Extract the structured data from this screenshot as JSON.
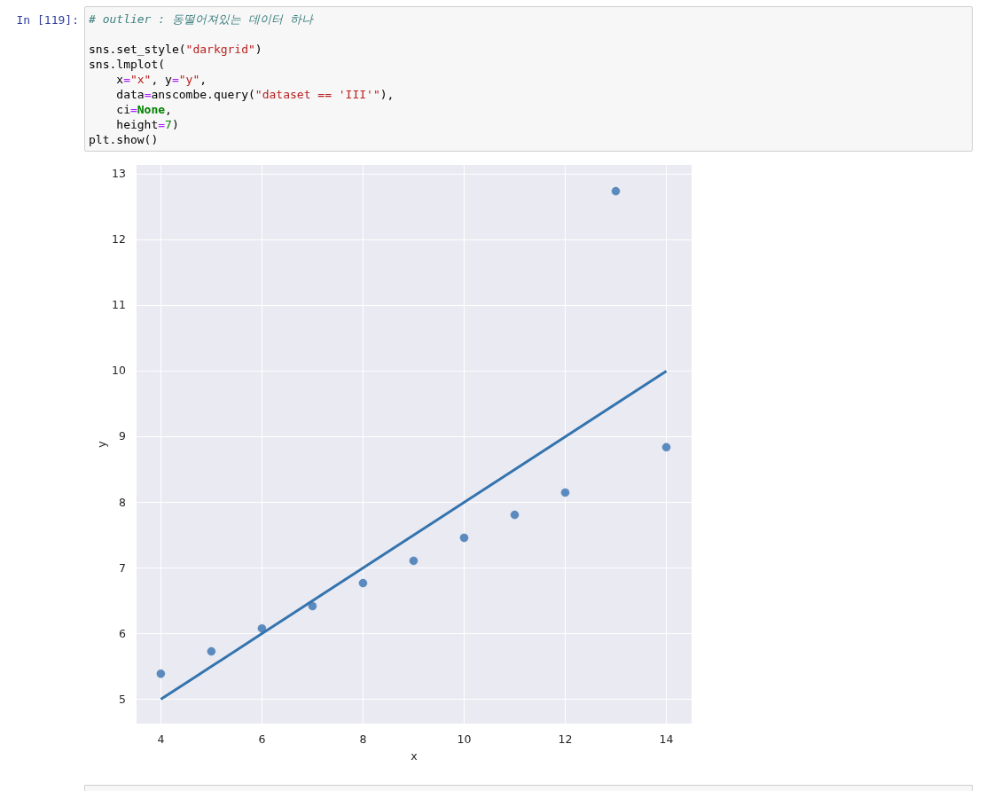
{
  "cell": {
    "prompt": "In [119]:",
    "lines": [
      {
        "tokens": [
          {
            "kind": "comment",
            "text": "# outlier : 동떨어져있는 데이터 하나"
          }
        ]
      },
      {
        "gap_before": true,
        "tokens": [
          {
            "kind": "plain",
            "text": "sns.set_style("
          },
          {
            "kind": "string",
            "text": "\"darkgrid\""
          },
          {
            "kind": "plain",
            "text": ")"
          }
        ]
      },
      {
        "tokens": [
          {
            "kind": "plain",
            "text": "sns.lmplot("
          }
        ]
      },
      {
        "tokens": [
          {
            "kind": "plain",
            "text": "    x"
          },
          {
            "kind": "op",
            "text": "="
          },
          {
            "kind": "string",
            "text": "\"x\""
          },
          {
            "kind": "plain",
            "text": ", y"
          },
          {
            "kind": "op",
            "text": "="
          },
          {
            "kind": "string",
            "text": "\"y\""
          },
          {
            "kind": "plain",
            "text": ","
          }
        ]
      },
      {
        "tokens": [
          {
            "kind": "plain",
            "text": "    data"
          },
          {
            "kind": "op",
            "text": "="
          },
          {
            "kind": "plain",
            "text": "anscombe.query("
          },
          {
            "kind": "string",
            "text": "\"dataset == 'III'\""
          },
          {
            "kind": "plain",
            "text": "),"
          }
        ]
      },
      {
        "tokens": [
          {
            "kind": "plain",
            "text": "    ci"
          },
          {
            "kind": "op",
            "text": "="
          },
          {
            "kind": "keyword",
            "text": "None"
          },
          {
            "kind": "plain",
            "text": ","
          }
        ]
      },
      {
        "tokens": [
          {
            "kind": "plain",
            "text": "    height"
          },
          {
            "kind": "op",
            "text": "="
          },
          {
            "kind": "number",
            "text": "7"
          },
          {
            "kind": "plain",
            "text": ")"
          }
        ]
      },
      {
        "tokens": [
          {
            "kind": "plain",
            "text": "plt.show()"
          }
        ]
      }
    ]
  },
  "output": {
    "chart_data": {
      "type": "scatter",
      "xlabel": "x",
      "ylabel": "y",
      "x": [
        4,
        5,
        6,
        7,
        8,
        9,
        10,
        11,
        12,
        13,
        14
      ],
      "series": [
        {
          "color": "#4a7fb8",
          "values": [
            5.39,
            5.73,
            6.08,
            6.42,
            6.77,
            7.11,
            7.46,
            7.81,
            8.15,
            12.74,
            8.84
          ]
        },
        {
          "type": "line",
          "color": "#3474ae",
          "values": [
            5,
            5.5,
            6,
            6.5,
            7,
            7.5,
            8,
            8.5,
            9,
            9.5,
            10
          ]
        }
      ],
      "xlim": [
        3.52,
        14.5
      ],
      "ylim": [
        4.63,
        13.14
      ],
      "grid": true,
      "xticks": [
        4,
        6,
        8,
        10,
        12,
        14
      ],
      "yticks": [
        5,
        6,
        7,
        8,
        9,
        10,
        11,
        12,
        13
      ]
    }
  }
}
